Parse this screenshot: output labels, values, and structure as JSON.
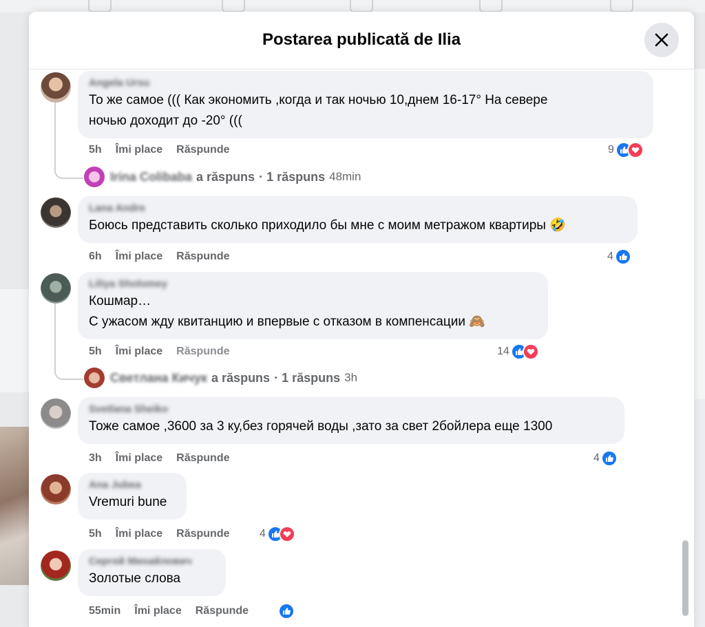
{
  "dialog": {
    "title": "Postarea publicată de Ilia"
  },
  "actions": {
    "like": "Îmi place",
    "reply": "Răspunde"
  },
  "comments": [
    {
      "author": "Angela Ursu",
      "lines": [
        "То же самое ((( Как экономить ,когда и так ночью 10,днем 16-17° На севере",
        "ночью доходит до -20° ((("
      ],
      "time": "5h",
      "reaction_count": "9",
      "reactions": [
        "like",
        "love"
      ],
      "reply_summary": {
        "author": "Irina Colibaba",
        "action": "a răspuns",
        "count": "· 1 răspuns",
        "time": "48min"
      }
    },
    {
      "author": "Lana Andre",
      "lines": [
        "Боюсь представить сколько приходило бы мне с моим метражом квартиры 🤣"
      ],
      "time": "6h",
      "reaction_count": "4",
      "reactions": [
        "like"
      ]
    },
    {
      "author": "Liliya Sholomey",
      "lines": [
        "Кошмар…",
        "С ужасом жду квитанцию и впервые с отказом в компенсации 🙈"
      ],
      "time": "5h",
      "reaction_count": "14",
      "reactions": [
        "like",
        "love"
      ],
      "reply_summary": {
        "author": "Светлана Кичук",
        "action": "a răspuns",
        "count": "· 1 răspuns",
        "time": "3h"
      }
    },
    {
      "author": "Svetlana Sheiko",
      "lines": [
        "Тоже самое ,3600 за 3 ку,без горячей воды ,зато за свет 2бойлера еще 1300"
      ],
      "time": "3h",
      "reaction_count": "4",
      "reactions": [
        "like"
      ]
    },
    {
      "author": "Ana Jubea",
      "lines": [
        "Vremuri bune"
      ],
      "time": "5h",
      "reaction_count": "4",
      "reactions": [
        "like",
        "love"
      ]
    },
    {
      "author": "Сергей Михайлович",
      "lines": [
        "Золотые слова"
      ],
      "time": "55min",
      "reaction_count": "",
      "reactions": [
        "like"
      ]
    }
  ],
  "colors": {
    "like": "#1877f2",
    "love": "#f33e58",
    "bubble": "#f0f2f5",
    "meta_text": "#65676b"
  }
}
